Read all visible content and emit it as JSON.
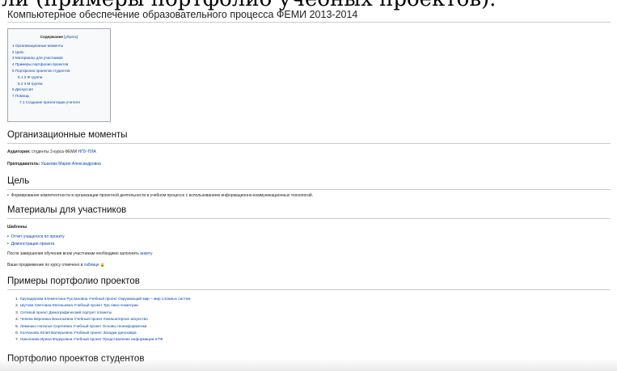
{
  "cropped_caption": "ли (примеры портфолио учебных проектов).",
  "page": {
    "title": "Компьютерное обеспечение образовательного процесса ФЕМИ 2013-2014"
  },
  "toc": {
    "heading": "Содержание",
    "hide_label": "[убрать]",
    "items": [
      {
        "label": "1 Организационные моменты",
        "level": 1
      },
      {
        "label": "2 Цель",
        "level": 1
      },
      {
        "label": "3 Материалы для участников",
        "level": 1
      },
      {
        "label": "4 Примеры портфолио проектов",
        "level": 1
      },
      {
        "label": "5 Портфолио проектов студентов",
        "level": 1
      },
      {
        "label": "5.1 3 Ф группа",
        "level": 2
      },
      {
        "label": "5.2 3 М группа",
        "level": 2
      },
      {
        "label": "6 Дискуссия",
        "level": 1
      },
      {
        "label": "7 Помощь",
        "level": 1
      },
      {
        "label": "7.1 Создание презентации учителя",
        "level": 3
      }
    ]
  },
  "sections": {
    "org": {
      "heading": "Организационные моменты",
      "audience_label": "Аудитория:",
      "audience_text": "студенты 3 курса ФЕМИ",
      "audience_link": "НПУ-ПЛА",
      "teacher_label": "Преподаватель:",
      "teacher_link": "Ушакова Мария Александровна"
    },
    "goal": {
      "heading": "Цель",
      "text": "Формирование компетентности в организации проектной деятельности в учебном процессе с использованием информационно-коммуникационных технологий."
    },
    "materials": {
      "heading": "Материалы для участников",
      "templates_label": "Шаблоны",
      "links": [
        "Отчет учащегося по проекту",
        "Демонстрация проекта"
      ],
      "after_text": "После завершения обучения всем участникам необходимо заполнить",
      "after_link": "анкету",
      "progress_text": "Ваше продвижение по курсу отмечено в",
      "progress_link": "таблице",
      "lock_icon": "lock-icon"
    },
    "examples": {
      "heading": "Примеры портфолио проектов",
      "items": [
        {
          "n": "1.",
          "text": "Крупадерова Клементина Руслановна Учебный проект Окружающий мир – мир сложных систем"
        },
        {
          "n": "2.",
          "text": "Шутова Светлана Евгеньевна   Учебный проект Три лика геометрии"
        },
        {
          "n": "3.",
          "text": "Сетевой проект Демографический портрет планеты"
        },
        {
          "n": "4.",
          "text": "Чепека Вероника Васильевна Учебный проект Компьютерное искусство"
        },
        {
          "n": "5.",
          "text": "Лемешко Наталья Сергеевна Учебный проект Основы геоинформатики"
        },
        {
          "n": "6.",
          "text": "Колчанова Юлия Валерьевна Учебный проект Загадки динозавра"
        },
        {
          "n": "7.",
          "text": "Николаева Ирина Федоровна Учебный проект Представление информации в ПК"
        }
      ]
    },
    "portfolio": {
      "heading": "Портфолио проектов студентов"
    }
  }
}
